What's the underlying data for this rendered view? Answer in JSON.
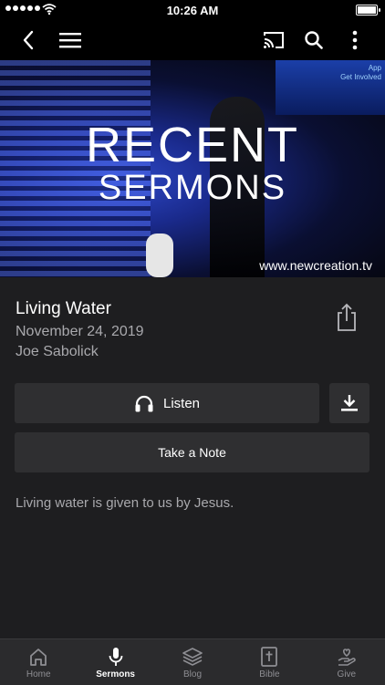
{
  "status_bar": {
    "time": "10:26 AM"
  },
  "nav": {
    "back_icon": "chevron-left-icon",
    "menu_icon": "hamburger-icon",
    "cast_icon": "cast-icon",
    "search_icon": "search-icon",
    "more_icon": "more-vertical-icon"
  },
  "banner": {
    "line1": "RECENT",
    "line2": "SERMONS",
    "url": "www.newcreation.tv",
    "screen_text_1": "App",
    "screen_text_2": "Get Involved"
  },
  "sermon": {
    "title": "Living Water",
    "date": "November 24, 2019",
    "speaker": "Joe Sabolick",
    "description": "Living water is given to us by Jesus."
  },
  "actions": {
    "listen_label": "Listen",
    "note_label": "Take a Note"
  },
  "tabs": [
    {
      "label": "Home",
      "icon": "home-icon",
      "active": false
    },
    {
      "label": "Sermons",
      "icon": "microphone-icon",
      "active": true
    },
    {
      "label": "Blog",
      "icon": "layers-icon",
      "active": false
    },
    {
      "label": "Bible",
      "icon": "bible-icon",
      "active": false
    },
    {
      "label": "Give",
      "icon": "give-hand-heart-icon",
      "active": false
    }
  ],
  "colors": {
    "background": "#1e1e20",
    "button_bg": "#2f2f31",
    "secondary_text": "#a9a9ad",
    "tab_bar": "#2b2b2d"
  }
}
